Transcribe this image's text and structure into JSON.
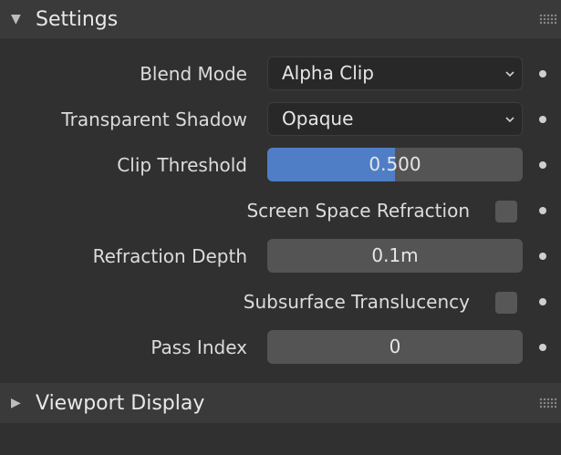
{
  "settings_panel": {
    "title": "Settings",
    "rows": {
      "blend_mode": {
        "label": "Blend Mode",
        "value": "Alpha Clip"
      },
      "transparent_shadow": {
        "label": "Transparent Shadow",
        "value": "Opaque"
      },
      "clip_threshold": {
        "label": "Clip Threshold",
        "value": "0.500",
        "fill_fraction": 0.5
      },
      "screen_space_refraction": {
        "label": "Screen Space Refraction",
        "checked": false
      },
      "refraction_depth": {
        "label": "Refraction Depth",
        "value": "0.1m"
      },
      "subsurface_translucency": {
        "label": "Subsurface Translucency",
        "checked": false
      },
      "pass_index": {
        "label": "Pass Index",
        "value": "0"
      }
    }
  },
  "viewport_display_panel": {
    "title": "Viewport Display",
    "collapsed": true
  },
  "colors": {
    "background": "#303030",
    "header": "#3a3a3a",
    "field": "#545454",
    "dropdown": "#282828",
    "slider_fill": "#4f7ec6"
  },
  "icons": {
    "expanded": "triangle-down-icon",
    "collapsed": "triangle-right-icon",
    "grip": "drag-grip-icon",
    "dropdown": "chevron-down-icon",
    "keyframe": "animate-property-dot-icon"
  }
}
